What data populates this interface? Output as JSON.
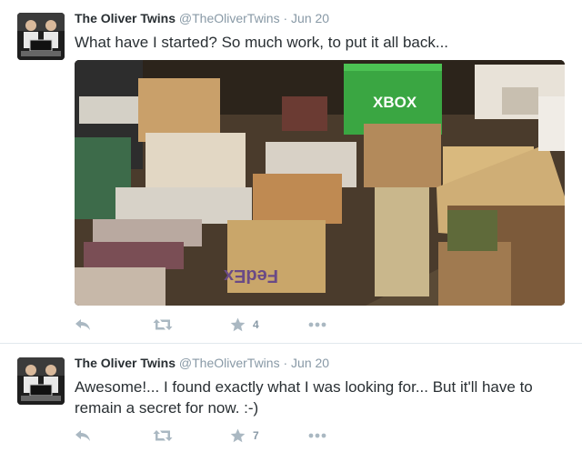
{
  "tweets": [
    {
      "fullname": "The Oliver Twins",
      "handle": "@TheOliverTwins",
      "separator": "·",
      "time": "Jun 20",
      "text": "What have I started?  So much work, to put it all back...",
      "media_labels": {
        "xbox": "XBOX",
        "fedex": "FedEx"
      },
      "favorites": "4"
    },
    {
      "fullname": "The Oliver Twins",
      "handle": "@TheOliverTwins",
      "separator": "·",
      "time": "Jun 20",
      "text": "Awesome!... I found exactly what I was looking for... But it'll have to remain a secret for now. :-)",
      "favorites": "7"
    }
  ],
  "icons": [
    "reply-icon",
    "retweet-icon",
    "favorite-star-icon",
    "more-dots-icon"
  ],
  "colors": {
    "action_gray": "#aab8c2",
    "name": "#292f33",
    "meta": "#8899a6"
  }
}
